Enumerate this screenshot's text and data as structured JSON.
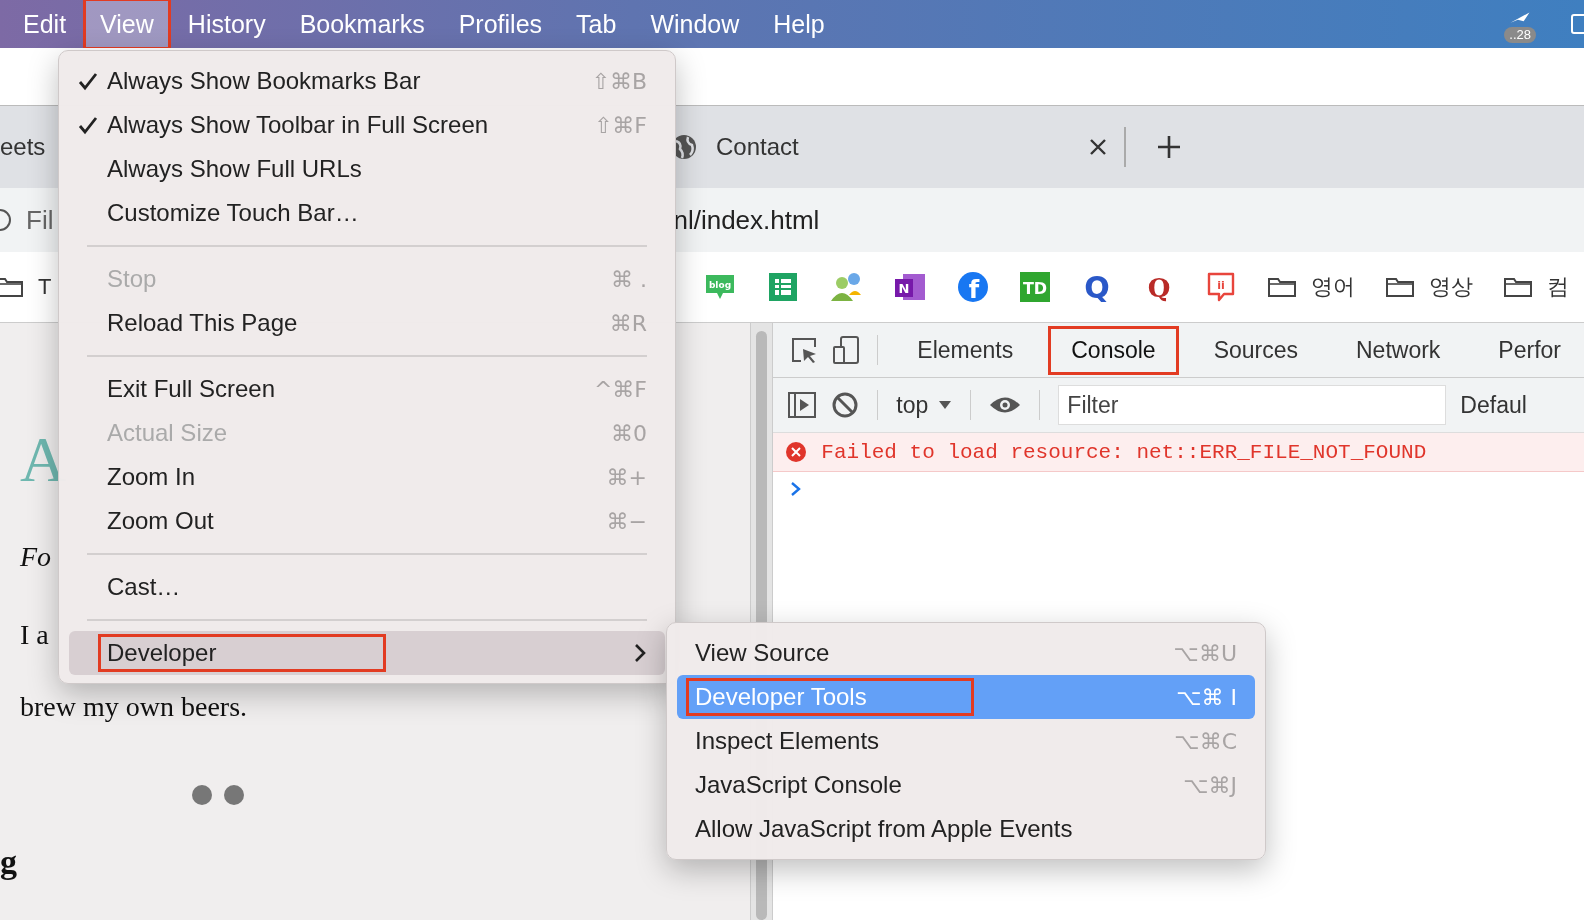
{
  "menu_bar": {
    "items": [
      {
        "label": "Edit",
        "selected": false,
        "annotated": false
      },
      {
        "label": "View",
        "selected": true,
        "annotated": true
      },
      {
        "label": "History",
        "selected": false,
        "annotated": false
      },
      {
        "label": "Bookmarks",
        "selected": false,
        "annotated": false
      },
      {
        "label": "Profiles",
        "selected": false,
        "annotated": false
      },
      {
        "label": "Tab",
        "selected": false,
        "annotated": false
      },
      {
        "label": "Window",
        "selected": false,
        "annotated": false
      },
      {
        "label": "Help",
        "selected": false,
        "annotated": false
      }
    ],
    "status_badge": "..28"
  },
  "browser": {
    "tabs": [
      {
        "label": "eets"
      },
      {
        "label": "Contact"
      }
    ],
    "address_bar": {
      "prefix": "Fil",
      "url": "nl/index.html"
    },
    "bookmarks": [
      {
        "kind": "folder",
        "label": "T"
      },
      {
        "kind": "blog",
        "text": "blog"
      },
      {
        "kind": "sheet"
      },
      {
        "kind": "people"
      },
      {
        "kind": "onenote",
        "text": "N"
      },
      {
        "kind": "facebook",
        "text": "f"
      },
      {
        "kind": "td",
        "text": "TD"
      },
      {
        "kind": "q-blue",
        "text": "Q"
      },
      {
        "kind": "q-red",
        "text": "Q"
      },
      {
        "kind": "chat",
        "text": "ii"
      },
      {
        "kind": "folder",
        "label": "영어"
      },
      {
        "kind": "folder",
        "label": "영상"
      },
      {
        "kind": "folder",
        "label": "컴"
      }
    ]
  },
  "page": {
    "heading": "A",
    "italic_line": "Fo",
    "line_1": "I a",
    "line_2": "brew my own beers.",
    "bottom_heading": "g"
  },
  "devtools": {
    "tabs": [
      {
        "label": "Elements",
        "selected": false,
        "annotated": false
      },
      {
        "label": "Console",
        "selected": true,
        "annotated": true
      },
      {
        "label": "Sources",
        "selected": false,
        "annotated": false
      },
      {
        "label": "Network",
        "selected": false,
        "annotated": false
      },
      {
        "label": "Perfor",
        "selected": false,
        "annotated": false
      }
    ],
    "context": "top",
    "filter_placeholder": "Filter",
    "levels": "Defaul",
    "messages": [
      {
        "kind": "error",
        "text": "Failed to load resource: net::ERR_FILE_NOT_FOUND"
      }
    ]
  },
  "view_menu": {
    "items": [
      {
        "kind": "item",
        "label": "Always Show Bookmarks Bar",
        "checked": true,
        "disabled": false,
        "shortcut": "⇧⌘B",
        "submenu": false,
        "selected": false,
        "annotated": false
      },
      {
        "kind": "item",
        "label": "Always Show Toolbar in Full Screen",
        "checked": true,
        "disabled": false,
        "shortcut": "⇧⌘F",
        "submenu": false,
        "selected": false,
        "annotated": false
      },
      {
        "kind": "item",
        "label": "Always Show Full URLs",
        "checked": false,
        "disabled": false,
        "submenu": false,
        "selected": false,
        "annotated": false
      },
      {
        "kind": "item",
        "label": "Customize Touch Bar…",
        "checked": false,
        "disabled": false,
        "submenu": false,
        "selected": false,
        "annotated": false
      },
      {
        "kind": "separator"
      },
      {
        "kind": "item",
        "label": "Stop",
        "checked": false,
        "disabled": true,
        "shortcut": "⌘ .",
        "submenu": false,
        "selected": false,
        "annotated": false
      },
      {
        "kind": "item",
        "label": "Reload This Page",
        "checked": false,
        "disabled": false,
        "shortcut": "⌘R",
        "submenu": false,
        "selected": false,
        "annotated": false
      },
      {
        "kind": "separator"
      },
      {
        "kind": "item",
        "label": "Exit Full Screen",
        "checked": false,
        "disabled": false,
        "shortcut": "^⌘F",
        "submenu": false,
        "selected": false,
        "annotated": false
      },
      {
        "kind": "item",
        "label": "Actual Size",
        "checked": false,
        "disabled": true,
        "shortcut": "⌘0",
        "submenu": false,
        "selected": false,
        "annotated": false
      },
      {
        "kind": "item",
        "label": "Zoom In",
        "checked": false,
        "disabled": false,
        "shortcut": "⌘+",
        "submenu": false,
        "selected": false,
        "annotated": false
      },
      {
        "kind": "item",
        "label": "Zoom Out",
        "checked": false,
        "disabled": false,
        "shortcut": "⌘−",
        "submenu": false,
        "selected": false,
        "annotated": false
      },
      {
        "kind": "separator"
      },
      {
        "kind": "item",
        "label": "Cast…",
        "checked": false,
        "disabled": false,
        "submenu": false,
        "selected": false,
        "annotated": false
      },
      {
        "kind": "separator"
      },
      {
        "kind": "item",
        "label": "Developer",
        "checked": false,
        "disabled": false,
        "submenu": true,
        "selected": true,
        "annotated": true
      }
    ]
  },
  "developer_menu": {
    "items": [
      {
        "kind": "item",
        "label": "View Source",
        "shortcut": "⌥⌘U",
        "selected": false,
        "annotated": false
      },
      {
        "kind": "item",
        "label": "Developer Tools",
        "shortcut": "⌥⌘ I",
        "selected": true,
        "annotated": true
      },
      {
        "kind": "item",
        "label": "Inspect Elements",
        "shortcut": "⌥⌘C",
        "selected": false,
        "annotated": false
      },
      {
        "kind": "item",
        "label": "JavaScript Console",
        "shortcut": "⌥⌘J",
        "selected": false,
        "annotated": false
      },
      {
        "kind": "item",
        "label": "Allow JavaScript from Apple Events",
        "selected": false,
        "annotated": false
      }
    ]
  }
}
